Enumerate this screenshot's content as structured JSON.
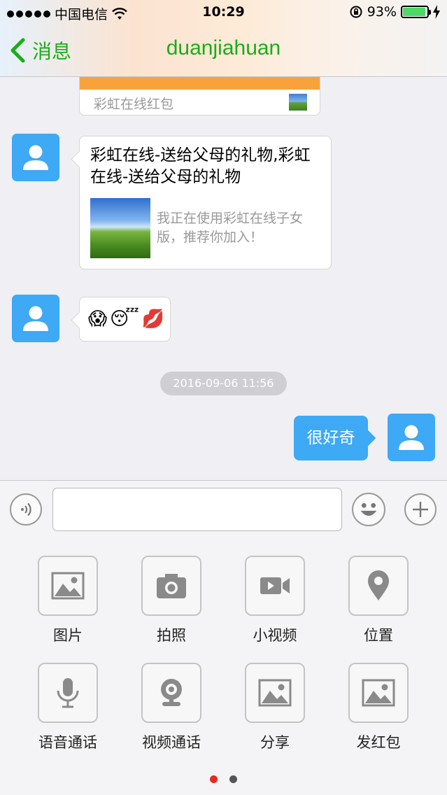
{
  "status_bar": {
    "carrier": "中国电信",
    "time": "10:29",
    "battery_text": "93%",
    "battery_level_percent": 93
  },
  "nav": {
    "back_label": "消息",
    "title": "duanjiahuan"
  },
  "messages": {
    "partial_card_title": "彩虹在线红包",
    "link_card": {
      "title": "彩虹在线-送给父母的礼物,彩虹在线-送给父母的礼物",
      "description": "我正在使用彩虹在线子女版，推荐你加入！"
    },
    "emojis": [
      "😱",
      "😴",
      "💋"
    ],
    "timestamp": "2016-09-06 11:56",
    "outgoing_text": "很好奇"
  },
  "input_bar": {
    "value": "",
    "placeholder": ""
  },
  "panel": {
    "items": [
      {
        "label": "图片",
        "icon": "image-icon"
      },
      {
        "label": "拍照",
        "icon": "camera-icon"
      },
      {
        "label": "小视频",
        "icon": "video-icon"
      },
      {
        "label": "位置",
        "icon": "location-icon"
      },
      {
        "label": "语音通话",
        "icon": "microphone-icon"
      },
      {
        "label": "视频通话",
        "icon": "webcam-icon"
      },
      {
        "label": "分享",
        "icon": "image-icon"
      },
      {
        "label": "发红包",
        "icon": "image-icon"
      }
    ]
  },
  "pager": {
    "active_page": 1,
    "total_pages": 2,
    "active_color": "#e8291c",
    "inactive_color": "#555555"
  },
  "colors": {
    "accent_green": "#1aad19",
    "avatar_blue": "#3ea9f5",
    "card_orange": "#f8a23b"
  }
}
